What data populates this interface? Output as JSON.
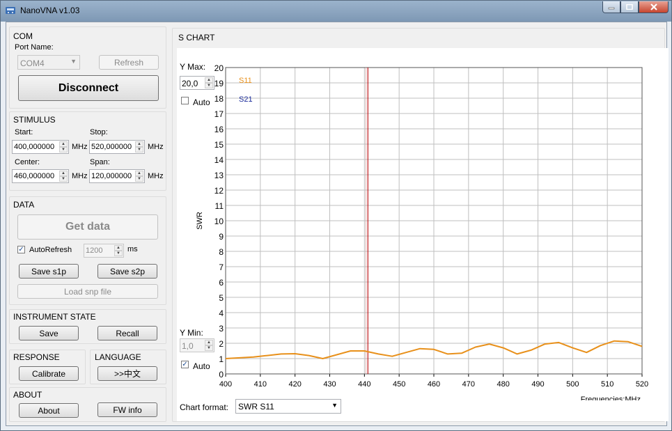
{
  "window": {
    "title": "NanoVNA v1.03",
    "icon": "nanovna-app-icon",
    "controls": [
      "minimize-icon",
      "maximize-icon",
      "close-icon"
    ]
  },
  "com": {
    "title": "COM",
    "port_label": "Port Name:",
    "port_value": "COM4",
    "refresh_label": "Refresh",
    "disconnect_label": "Disconnect"
  },
  "stimulus": {
    "title": "STIMULUS",
    "start_label": "Start:",
    "start_value": "400,000000",
    "stop_label": "Stop:",
    "stop_value": "520,000000",
    "center_label": "Center:",
    "center_value": "460,000000",
    "span_label": "Span:",
    "span_value": "120,000000",
    "unit": "MHz"
  },
  "data": {
    "title": "DATA",
    "get_data_label": "Get data",
    "autorefresh_label": "AutoRefresh",
    "autorefresh_checked": true,
    "interval_value": "1200",
    "interval_unit": "ms",
    "save_s1p_label": "Save s1p",
    "save_s2p_label": "Save s2p",
    "load_snp_label": "Load snp file"
  },
  "instrument_state": {
    "title": "INSTRUMENT STATE",
    "save_label": "Save",
    "recall_label": "Recall"
  },
  "response": {
    "title": "RESPONSE",
    "calibrate_label": "Calibrate"
  },
  "language": {
    "title": "LANGUAGE",
    "switch_label": ">>中文"
  },
  "about": {
    "title": "ABOUT",
    "about_label": "About",
    "fw_info_label": "FW info"
  },
  "schart": {
    "title": "S CHART",
    "ymax_label": "Y Max:",
    "ymax_value": "20,0",
    "ymax_auto_label": "Auto",
    "ymax_auto_checked": false,
    "ymin_label": "Y Min:",
    "ymin_value": "1,0",
    "ymin_auto_label": "Auto",
    "ymin_auto_checked": true,
    "chart_format_label": "Chart format:",
    "chart_format_value": "SWR S11"
  },
  "chart_data": {
    "type": "line",
    "title": "",
    "xlabel": "Frequencies:MHz",
    "ylabel": "SWR",
    "xlim": [
      400,
      520
    ],
    "ylim": [
      0,
      20
    ],
    "grid": true,
    "x_ticks": [
      400,
      410,
      420,
      430,
      440,
      450,
      460,
      470,
      480,
      490,
      500,
      510,
      520
    ],
    "y_ticks": [
      0,
      1,
      2,
      3,
      4,
      5,
      6,
      7,
      8,
      9,
      10,
      11,
      12,
      13,
      14,
      15,
      16,
      17,
      18,
      19,
      20
    ],
    "legend_position": "top-left",
    "marker_x": 441,
    "series": [
      {
        "name": "S11",
        "color": "#e8901a",
        "x": [
          400,
          404,
          408,
          412,
          416,
          420,
          424,
          428,
          432,
          436,
          440,
          444,
          448,
          452,
          456,
          460,
          464,
          468,
          472,
          476,
          480,
          484,
          488,
          492,
          496,
          500,
          504,
          508,
          512,
          516,
          520
        ],
        "y": [
          1.0,
          1.05,
          1.1,
          1.2,
          1.3,
          1.32,
          1.2,
          1.0,
          1.25,
          1.5,
          1.5,
          1.3,
          1.15,
          1.4,
          1.65,
          1.6,
          1.3,
          1.35,
          1.75,
          1.95,
          1.7,
          1.3,
          1.55,
          1.95,
          2.05,
          1.7,
          1.4,
          1.85,
          2.15,
          2.1,
          1.8
        ]
      },
      {
        "name": "S21",
        "color": "#1c2d9c",
        "x": [],
        "y": []
      }
    ]
  }
}
